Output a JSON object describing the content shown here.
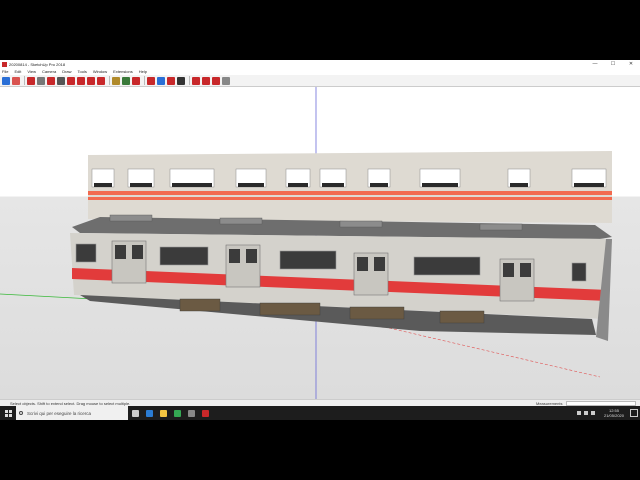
{
  "window": {
    "title": "20200814 - SketchUp Pro 2018",
    "minimize": "—",
    "maximize": "☐",
    "close": "✕"
  },
  "menu": [
    "File",
    "Edit",
    "View",
    "Camera",
    "Draw",
    "Tools",
    "Window",
    "Extensions",
    "Help"
  ],
  "toolbar": {
    "icons": [
      "select-icon",
      "eraser-icon",
      "line-icon",
      "arc-icon",
      "rectangle-icon",
      "push-pull-icon",
      "move-icon",
      "rotate-icon",
      "scale-icon",
      "offset-icon",
      "tape-icon",
      "text-icon",
      "paint-icon",
      "orbit-icon",
      "pan-icon",
      "zoom-icon",
      "zoom-extents-icon",
      "warehouse-icon",
      "extension-icon",
      "ruby-icon",
      "sandbox-icon"
    ],
    "colors": [
      "#2a6fd6",
      "#d9534f",
      "#c8282a",
      "#777777",
      "#c8282a",
      "#555555",
      "#c8282a",
      "#c8282a",
      "#c8282a",
      "#c8282a",
      "#b08a2a",
      "#3a7a3a",
      "#c8282a",
      "#c8282a",
      "#2a6fd6",
      "#c8282a",
      "#333333",
      "#c8282a",
      "#c8282a",
      "#c8282a",
      "#888888"
    ]
  },
  "status": {
    "hint": "Select objects. Shift to extend select. Drag mouse to select multiple.",
    "measurements_label": "Measurements"
  },
  "taskbar": {
    "search_placeholder": "Scrivi qui per eseguire la ricerca",
    "time": "12:55",
    "date": "21/05/2020",
    "apps": [
      {
        "name": "task-view-icon",
        "color": "#cccccc"
      },
      {
        "name": "edge-icon",
        "color": "#2b7cd3"
      },
      {
        "name": "file-explorer-icon",
        "color": "#f4c542"
      },
      {
        "name": "chrome-icon",
        "color": "#34a853"
      },
      {
        "name": "settings-icon",
        "color": "#888888"
      },
      {
        "name": "sketchup-icon",
        "color": "#c8282a"
      }
    ]
  },
  "scene": {
    "sky_color": "#ffffff",
    "ground_color": "#e0e0e0",
    "train_body_color": "#d4d2cc",
    "stripe_color": "#e23b3b",
    "roof_color": "#6e6e6e",
    "window_color": "#3b3b3b",
    "side_panel_color": "#dedad2",
    "side_stripe_color": "#f26a4f",
    "side_panel_window_color": "#ffffff"
  }
}
